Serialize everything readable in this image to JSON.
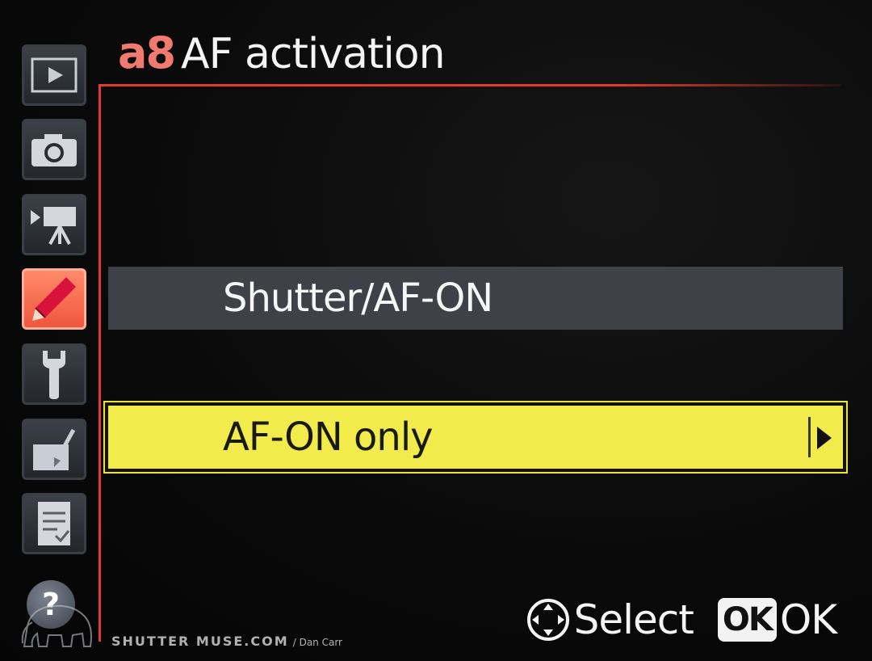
{
  "menu": {
    "code": "a8",
    "title": "AF activation"
  },
  "sidebar": {
    "tabs": [
      {
        "icon": "playback-icon"
      },
      {
        "icon": "camera-icon"
      },
      {
        "icon": "movie-camera-icon"
      },
      {
        "icon": "pencil-icon",
        "active": true
      },
      {
        "icon": "wrench-icon"
      },
      {
        "icon": "retouch-icon"
      },
      {
        "icon": "recent-settings-icon"
      }
    ],
    "help_label": "?"
  },
  "options": [
    {
      "label": "Shutter/AF-ON",
      "selected": false
    },
    {
      "label": "AF-ON only",
      "selected": true
    }
  ],
  "footer": {
    "select_label": "Select",
    "ok_box_label": "OK",
    "ok_label": "OK"
  },
  "watermark": {
    "site": "SHUTTER MUSE.COM",
    "credit": "/ Dan Carr"
  },
  "colors": {
    "accent_red": "#e23a2e",
    "selected_yellow": "#f1ec4c",
    "title_code": "#f07a70"
  }
}
